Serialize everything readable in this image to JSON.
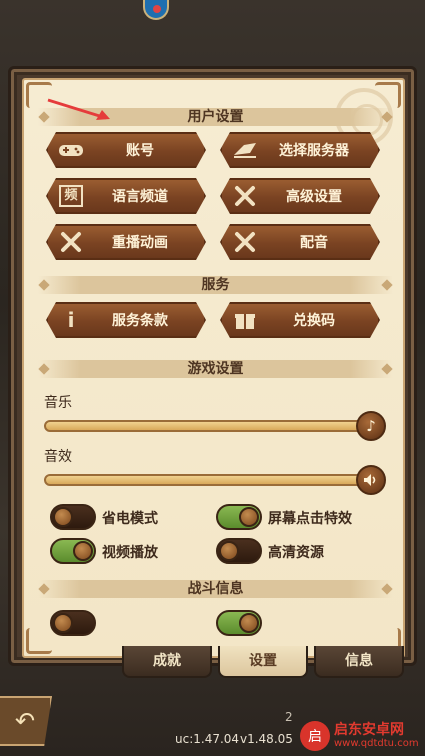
{
  "header": {
    "partial_badge": ""
  },
  "sections": {
    "user_settings": "用户设置",
    "service": "服务",
    "game_settings": "游戏设置",
    "battle_info": "战斗信息"
  },
  "buttons": {
    "account": "账号",
    "select_server": "选择服务器",
    "language_channel": "语言频道",
    "advanced_settings": "高级设置",
    "replay_animation": "重播动画",
    "dubbing": "配音",
    "terms": "服务条款",
    "redeem": "兑换码",
    "language_icon_text": "频"
  },
  "sliders": {
    "music": {
      "label": "音乐",
      "value": 1.0
    },
    "sfx": {
      "label": "音效",
      "value": 1.0
    }
  },
  "toggles": [
    {
      "label": "省电模式",
      "on": false
    },
    {
      "label": "屏幕点击特效",
      "on": true
    },
    {
      "label": "视频播放",
      "on": true
    },
    {
      "label": "高清资源",
      "on": false
    }
  ],
  "tabs": {
    "achievements": "成就",
    "settings": "设置",
    "info": "信息"
  },
  "footer": {
    "version_left": "uc:1.47.04",
    "version_right": "v1.48.05",
    "partial_number": "2"
  },
  "watermark": {
    "title": "启东安卓网",
    "url": "www.qdtdtu.com",
    "logo_text": "启"
  },
  "colors": {
    "panel_bg": "#f3e6c7",
    "button_brown": "#7a4322",
    "toggle_on": "#5b8c2d",
    "toggle_off": "#2d1a0e",
    "slider_fill": "#d9a95a",
    "arrow_red": "#e53b3b"
  }
}
